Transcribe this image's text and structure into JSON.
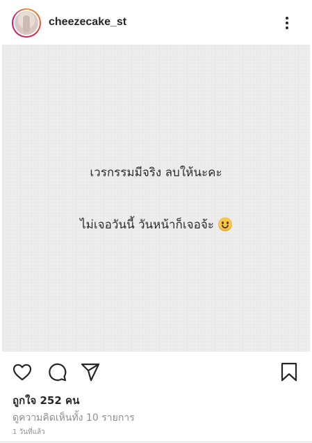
{
  "header": {
    "username": "cheezecake_st",
    "more_icon": "more-vertical-icon"
  },
  "post": {
    "line1": "เวรกรรมมีจริง ลบให้นะคะ",
    "line2": "ไม่เจอวันนี้ วันหน้าก็เจอจ้ะ",
    "emoji": "slightly-smiling-face",
    "background_color": "#ececec"
  },
  "actions": {
    "like_icon": "heart-icon",
    "comment_icon": "comment-icon",
    "share_icon": "send-icon",
    "save_icon": "bookmark-icon"
  },
  "meta": {
    "likes": "ถูกใจ 252 คน",
    "view_comments": "ดูความคิดเห็นทั้ง 10 รายการ",
    "timestamp": "1 วันที่แล้ว"
  }
}
